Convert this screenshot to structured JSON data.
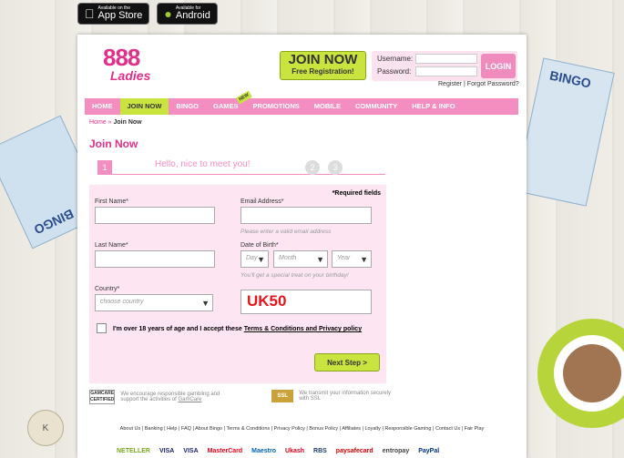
{
  "stores": [
    {
      "icon": "apple-icon",
      "small": "Available on the",
      "big": "App Store"
    },
    {
      "icon": "android-icon",
      "small": "Available for",
      "big": "Android"
    }
  ],
  "deco": {
    "bingo_left": "BINGO",
    "bingo_right": "BINGO",
    "ball": "K"
  },
  "logo": {
    "top": "888",
    "bottom": "Ladies"
  },
  "join_button": {
    "title": "JOIN NOW",
    "subtitle": "Free Registration!"
  },
  "login": {
    "username_label": "Username:",
    "password_label": "Password:",
    "button": "LOGIN",
    "register": "Register",
    "separator": " | ",
    "forgot": "Forgot Password?"
  },
  "nav": [
    {
      "label": "HOME"
    },
    {
      "label": "JOIN NOW"
    },
    {
      "label": "BINGO"
    },
    {
      "label": "GAMES"
    },
    {
      "label": "PROMOTIONS"
    },
    {
      "label": "MOBILE"
    },
    {
      "label": "COMMUNITY"
    },
    {
      "label": "HELP & INFO"
    }
  ],
  "nav_badge": "NEW",
  "breadcrumb": {
    "home": "Home",
    "sep": " » ",
    "current": "Join Now"
  },
  "page_title": "Join Now",
  "steps": {
    "one": "1",
    "hello": "Hello, nice to meet you!",
    "two": "2",
    "three": "3"
  },
  "form": {
    "required": "*Required fields",
    "first_name": "First Name*",
    "last_name": "Last Name*",
    "country": "Country*",
    "country_placeholder": "choose country",
    "email": "Email Address*",
    "email_hint": "Please enter a valid email address",
    "dob": "Date of Birth*",
    "day": "Day",
    "month": "Month",
    "year": "Year",
    "dob_hint": "You'll get a special treat on your birthday!",
    "promo_code": "UK50",
    "agree_text": "I'm over 18 years of age and I accept these ",
    "agree_link": "Terms & Conditions and Privacy policy",
    "next": "Next Step >"
  },
  "responsible": {
    "badge": "GAMCARE CERTIFIED",
    "text": "We encourage responsible gambling and support the activities of ",
    "link": "GamCare"
  },
  "ssl": {
    "badge": "SSL",
    "text": "We transmit your information securely with SSL"
  },
  "footer": "About Us | Banking | Help | FAQ | About Bingo | Terms & Conditions | Privacy Policy | Bonus Policy | Affiliates | Loyalty | Responsible Gaming | Contact Us | Fair Play",
  "payments": [
    "NETELLER",
    "VISA",
    "VISA",
    "MasterCard",
    "Maestro",
    "Ukash",
    "RBS",
    "paysafecard",
    "entropay",
    "PayPal"
  ]
}
